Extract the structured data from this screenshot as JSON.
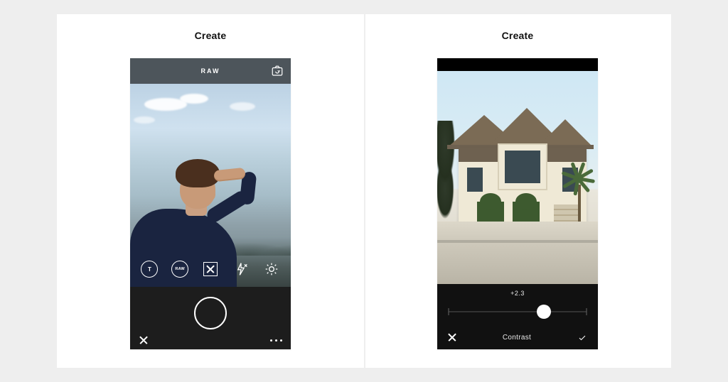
{
  "left": {
    "title": "Create",
    "camera": {
      "mode_label": "RAW",
      "tools": {
        "timer_label": "T",
        "raw_badge": "RAW"
      }
    }
  },
  "right": {
    "title": "Create",
    "editor": {
      "param_label": "Contrast",
      "value_label": "+2.3",
      "value": 2.3,
      "min": -6,
      "max": 6
    }
  }
}
